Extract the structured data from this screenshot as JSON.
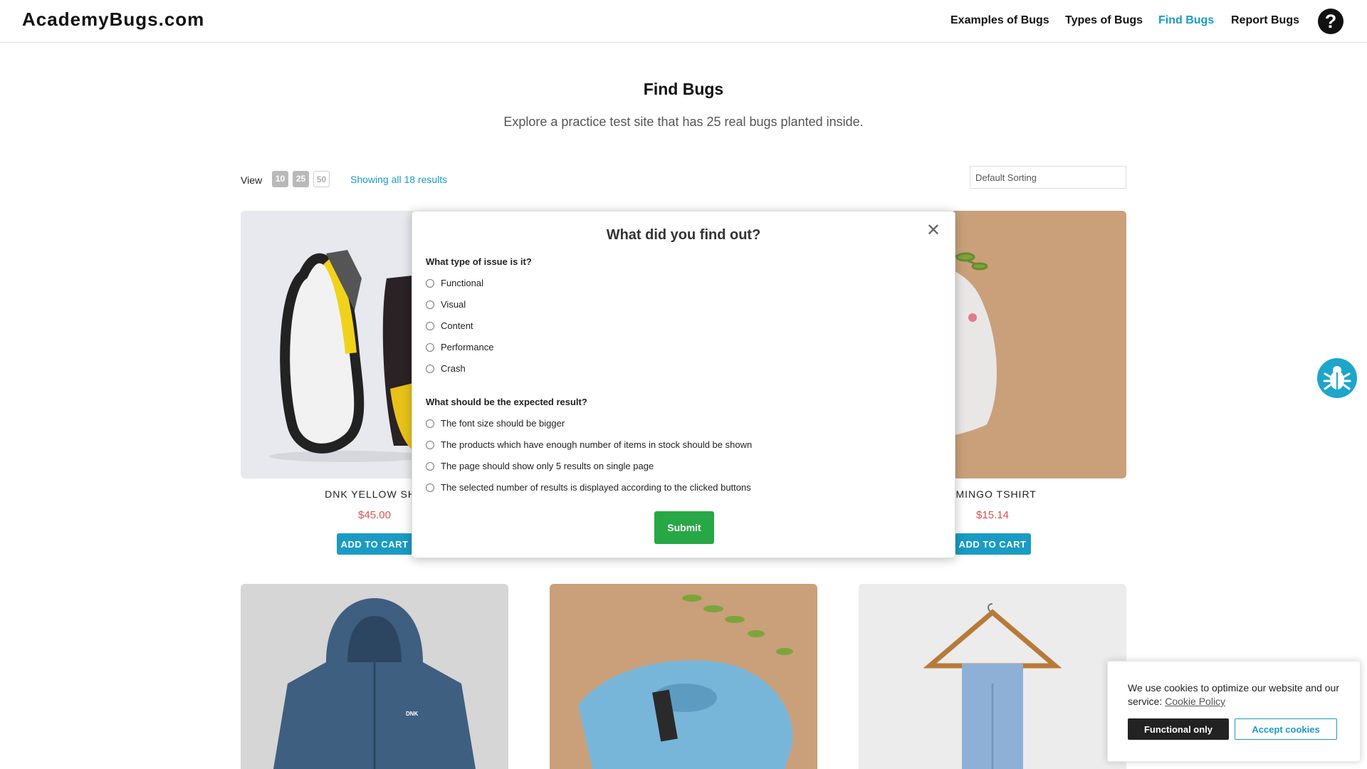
{
  "header": {
    "logo": "AcademyBugs.com",
    "nav": [
      {
        "label": "Examples of Bugs",
        "active": false
      },
      {
        "label": "Types of Bugs",
        "active": false
      },
      {
        "label": "Find Bugs",
        "active": true
      },
      {
        "label": "Report Bugs",
        "active": false
      }
    ],
    "help_icon": "question-mark-icon"
  },
  "page": {
    "title": "Find Bugs",
    "subtitle": "Explore a practice test site that has 25 real bugs planted inside."
  },
  "toolbar": {
    "view_label": "View",
    "view_options": [
      "10",
      "25",
      "50"
    ],
    "results_text": "Showing all 18 results",
    "sort_value": "Default Sorting"
  },
  "products": [
    {
      "name": "DNK YELLOW SHO",
      "price": "$45.00",
      "button": "ADD TO CART"
    },
    {
      "name": "AMINGO TSHIRT",
      "price": "$15.14",
      "button": "ADD TO CART"
    }
  ],
  "modal": {
    "title": "What did you find out?",
    "close_icon": "close-icon",
    "question1": "What type of issue is it?",
    "issue_types": [
      "Functional",
      "Visual",
      "Content",
      "Performance",
      "Crash"
    ],
    "question2": "What should be the expected result?",
    "expected_results": [
      "The font size should be bigger",
      "The products which have enough number of items in stock should be shown",
      "The page should show only 5 results on single page",
      "The selected number of results is displayed according to the clicked buttons"
    ],
    "submit": "Submit"
  },
  "cookie": {
    "text": "We use cookies to optimize our website and our service:",
    "link": "Cookie Policy",
    "functional_btn": "Functional only",
    "accept_btn": "Accept cookies"
  },
  "colors": {
    "accent": "#1a9bc4",
    "price": "#d9534f",
    "submit": "#28a745"
  },
  "floating_icon": "bug-icon"
}
